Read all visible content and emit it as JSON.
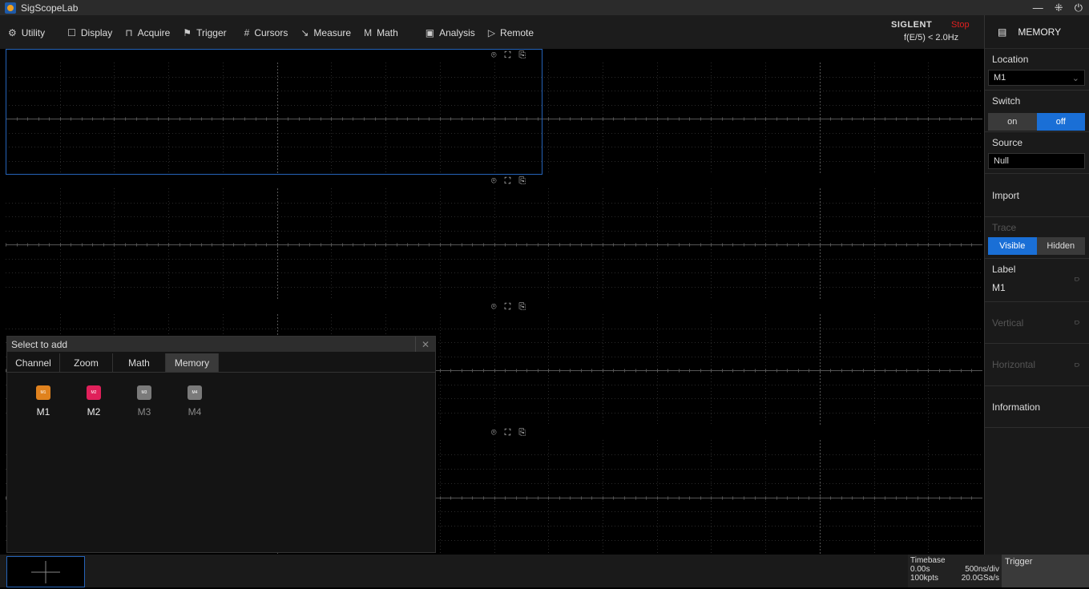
{
  "app": {
    "title": "SigScopeLab"
  },
  "menu": {
    "items": [
      {
        "label": "Utility",
        "icon": "⚙"
      },
      {
        "label": "Display",
        "icon": "☐"
      },
      {
        "label": "Acquire",
        "icon": "⊓"
      },
      {
        "label": "Trigger",
        "icon": "⚑"
      },
      {
        "label": "Cursors",
        "icon": "#"
      },
      {
        "label": "Measure",
        "icon": "↘"
      },
      {
        "label": "Math",
        "icon": "M"
      },
      {
        "label": "Analysis",
        "icon": "▣"
      },
      {
        "label": "Remote",
        "icon": "▷"
      }
    ]
  },
  "status": {
    "brand": "SIGLENT",
    "state": "Stop",
    "trigger_freq": "f(E/5) < 2.0Hz"
  },
  "side_panel": {
    "header": "MEMORY",
    "location_label": "Location",
    "location_value": "M1",
    "switch_label": "Switch",
    "switch_on": "on",
    "switch_off": "off",
    "source_label": "Source",
    "source_value": "Null",
    "import_label": "Import",
    "trace_label": "Trace",
    "trace_visible": "Visible",
    "trace_hidden": "Hidden",
    "label_label": "Label",
    "label_value": "M1",
    "vertical_label": "Vertical",
    "horizontal_label": "Horizontal",
    "information_label": "Information"
  },
  "dialog": {
    "title": "Select to add",
    "tabs": [
      "Channel",
      "Zoom",
      "Math",
      "Memory"
    ],
    "active_tab": "Memory",
    "tiles": [
      {
        "label": "M1",
        "small": "M1",
        "color": "#e0821e",
        "enabled": true
      },
      {
        "label": "M2",
        "small": "M2",
        "color": "#e0205a",
        "enabled": true
      },
      {
        "label": "M3",
        "small": "M3",
        "color": "#7a7a7a",
        "enabled": false
      },
      {
        "label": "M4",
        "small": "M4",
        "color": "#7a7a7a",
        "enabled": false
      }
    ]
  },
  "timebase": {
    "label": "Timebase",
    "delay": "0.00s",
    "scale": "500ns/div",
    "points": "100kpts",
    "rate": "20.0GSa/s"
  },
  "trigger": {
    "label": "Trigger"
  },
  "colors": {
    "accent": "#1a6fd6",
    "toggle_off": "#1a6fd6",
    "toggle_on_bg": "#3a3a3a"
  }
}
